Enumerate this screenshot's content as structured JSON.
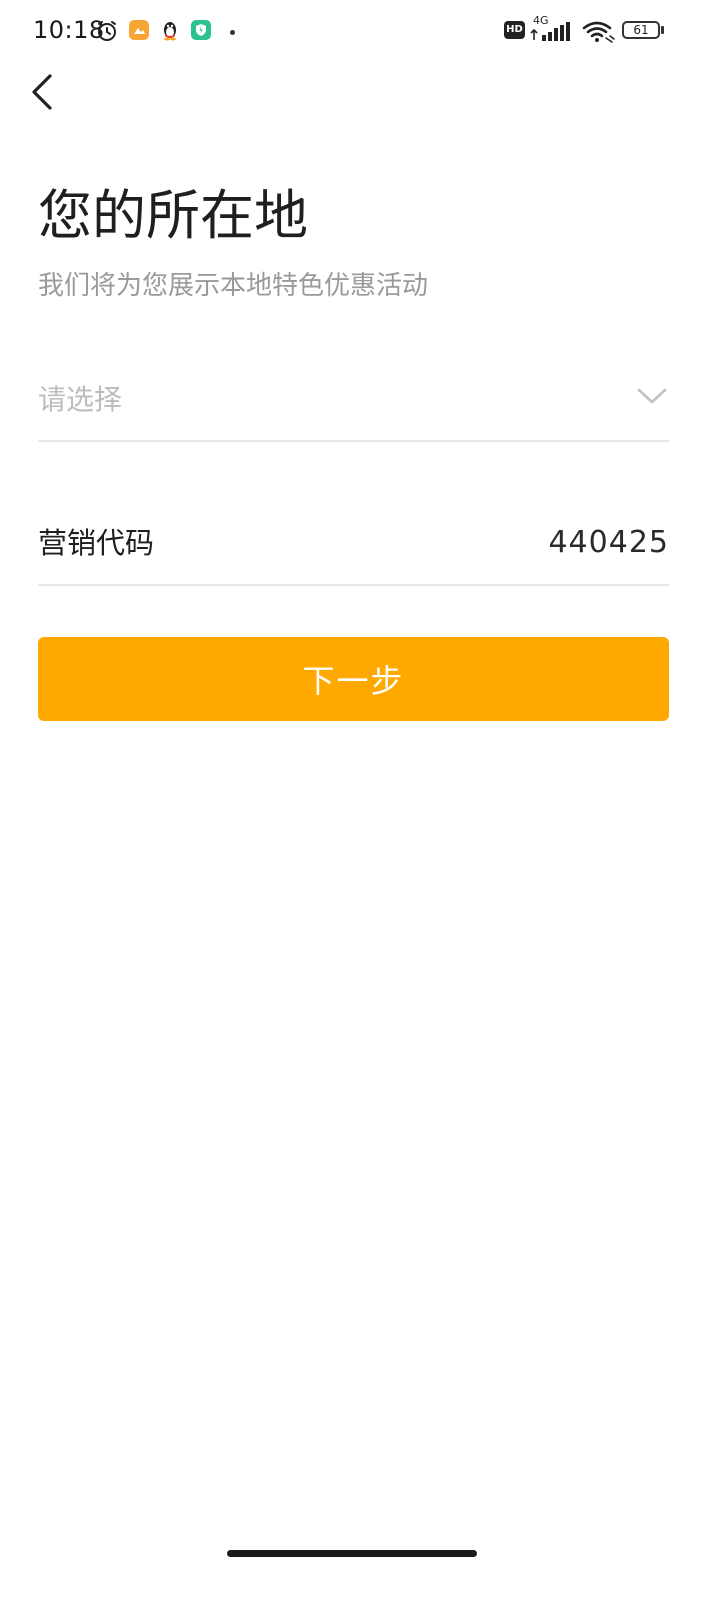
{
  "status_bar": {
    "time": "10:18",
    "network": "4G",
    "hd_label": "HD",
    "battery": "61"
  },
  "header": {
    "back_icon": "chevron-left-icon"
  },
  "main": {
    "title": "您的所在地",
    "subtitle": "我们将为您展示本地特色优惠活动",
    "location_select": {
      "placeholder": "请选择",
      "icon": "chevron-down-icon"
    },
    "marketing_code": {
      "label": "营销代码",
      "value": "440425"
    },
    "next_button_label": "下一步"
  },
  "colors": {
    "accent": "#FFA800",
    "placeholder": "#BDBDBD",
    "subtitle": "#9A9A9A",
    "divider": "#E8E8E8"
  }
}
